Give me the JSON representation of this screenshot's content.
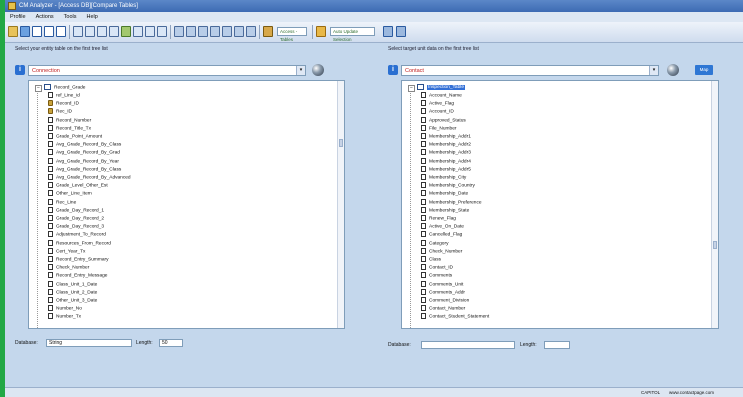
{
  "window": {
    "title": "CM Analyzer - [Access DB][Compare Tables]"
  },
  "menu": [
    "Profile",
    "Actions",
    "Tools",
    "Help"
  ],
  "toolbar": {
    "combo_label": "Access - Tables",
    "combo2_label": "Auto Update Selection"
  },
  "left_panel": {
    "label": "Select your entity table on the first tree list",
    "dropdown_value": "Connection",
    "root": "Record_Grade",
    "fields": [
      "ref_Line_id",
      "Record_ID",
      "Rec_ID",
      "Record_Number",
      "Record_Title_Tx",
      "Grade_Point_Amount",
      "Avg_Grade_Record_By_Class",
      "Avg_Grade_Record_By_Grad",
      "Avg_Grade_Record_By_Year",
      "Avg_Grade_Record_By_Class",
      "Avg_Grade_Record_By_Advanced",
      "Grade_Level_Other_Est",
      "Other_Line_Item",
      "Rec_Line",
      "Grade_Day_Record_1",
      "Grade_Day_Record_2",
      "Grade_Day_Record_3",
      "Adjustment_To_Record",
      "Resources_From_Record",
      "Cert_Year_Tx",
      "Record_Entry_Summary",
      "Check_Number",
      "Record_Entry_Message",
      "Class_Unit_1_Date",
      "Class_Unit_2_Date",
      "Other_Unit_3_Date",
      "Number_No",
      "Number_Tx"
    ],
    "key_rows": [
      1,
      2
    ],
    "database_label": "Database:",
    "database_value": "String",
    "length_label": "Length:",
    "length_value": "50"
  },
  "right_panel": {
    "label": "Select target unit data on the first tree list",
    "dropdown_value": "Contact",
    "button_label": "Map",
    "root": "Inspection_Table",
    "fields": [
      "Account_Name",
      "Active_Flag",
      "Account_ID",
      "Approved_Status",
      "File_Number",
      "Membership_Addr1",
      "Membership_Addr2",
      "Membership_Addr3",
      "Membership_Addr4",
      "Membership_Addr5",
      "Membership_City",
      "Membership_Country",
      "Membership_Date",
      "Membership_Preference",
      "Membership_State",
      "Renew_Flag",
      "Active_On_Date",
      "Cancelled_Flag",
      "Category",
      "Check_Number",
      "Class",
      "Contact_ID",
      "Comments",
      "Comments_Unit",
      "Comments_Addr",
      "Comment_Division",
      "Contact_Number",
      "Contact_Student_Statement"
    ],
    "database_label": "Database:",
    "database_value": "",
    "length_label": "Length:",
    "length_value": ""
  },
  "status": {
    "left": "",
    "right1": "CAPITOL",
    "right2": "www.contactpage.com"
  }
}
